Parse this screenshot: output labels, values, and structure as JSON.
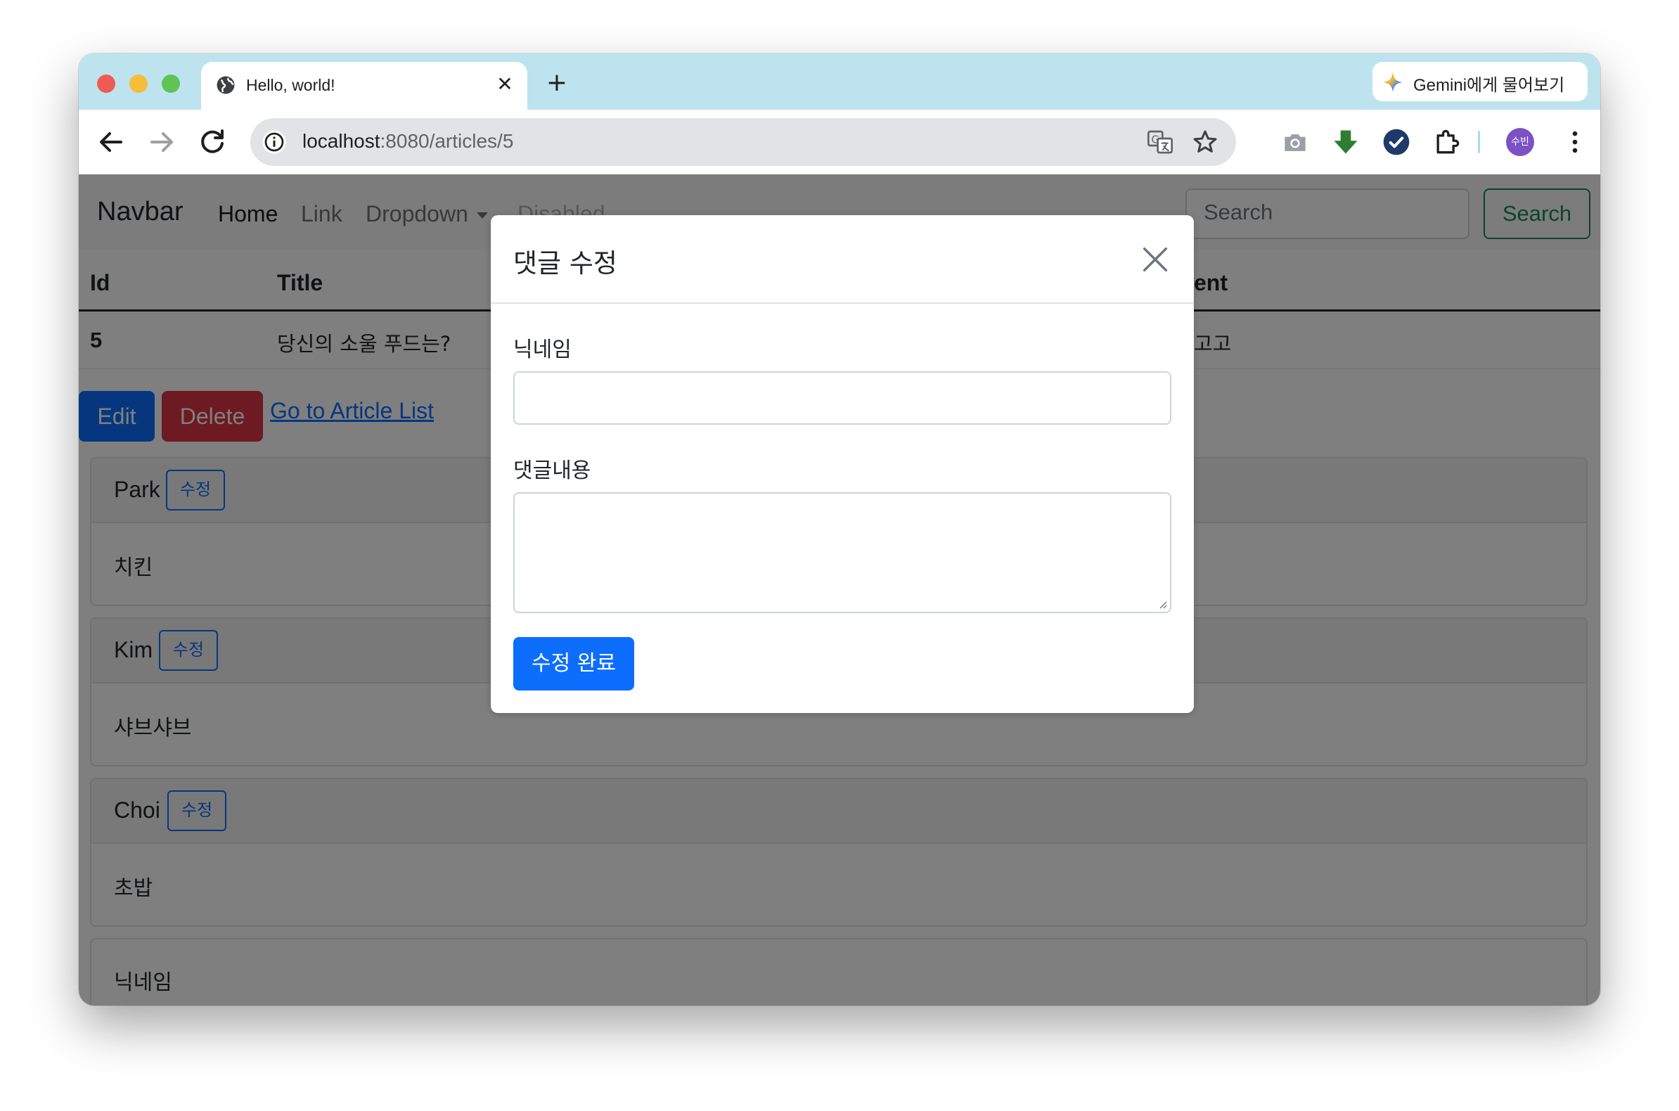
{
  "browser": {
    "tab_title": "Hello, world!",
    "tab_close": "✕",
    "new_tab": "+",
    "gemini_label": "Gemini에게 물어보기",
    "url_host": "localhost",
    "url_path": ":8080/articles/5",
    "avatar_text": "수빈"
  },
  "navbar": {
    "brand": "Navbar",
    "links": [
      "Home",
      "Link",
      "Dropdown",
      "Disabled"
    ],
    "search_placeholder": "Search",
    "search_button": "Search"
  },
  "article_table": {
    "headers": [
      "Id",
      "Title",
      "ent"
    ],
    "row": {
      "id": "5",
      "title": "당신의 소울 푸드는?",
      "content": "고고"
    }
  },
  "actions": {
    "edit": "Edit",
    "delete": "Delete",
    "list_link": "Go to Article List"
  },
  "comments": [
    {
      "nickname": "Park",
      "edit_label": "수정",
      "body": "치킨"
    },
    {
      "nickname": "Kim",
      "edit_label": "수정",
      "body": "샤브샤브"
    },
    {
      "nickname": "Choi",
      "edit_label": "수정",
      "body": "초밥"
    }
  ],
  "new_comment": {
    "nickname_label": "닉네임"
  },
  "modal": {
    "title": "댓글 수정",
    "nickname_label": "닉네임",
    "nickname_value": "",
    "body_label": "댓글내용",
    "body_value": "",
    "submit": "수정 완료"
  },
  "colors": {
    "primary": "#0d6efd",
    "danger": "#dc3545",
    "success": "#198754",
    "tabstrip": "#bde3ef"
  }
}
